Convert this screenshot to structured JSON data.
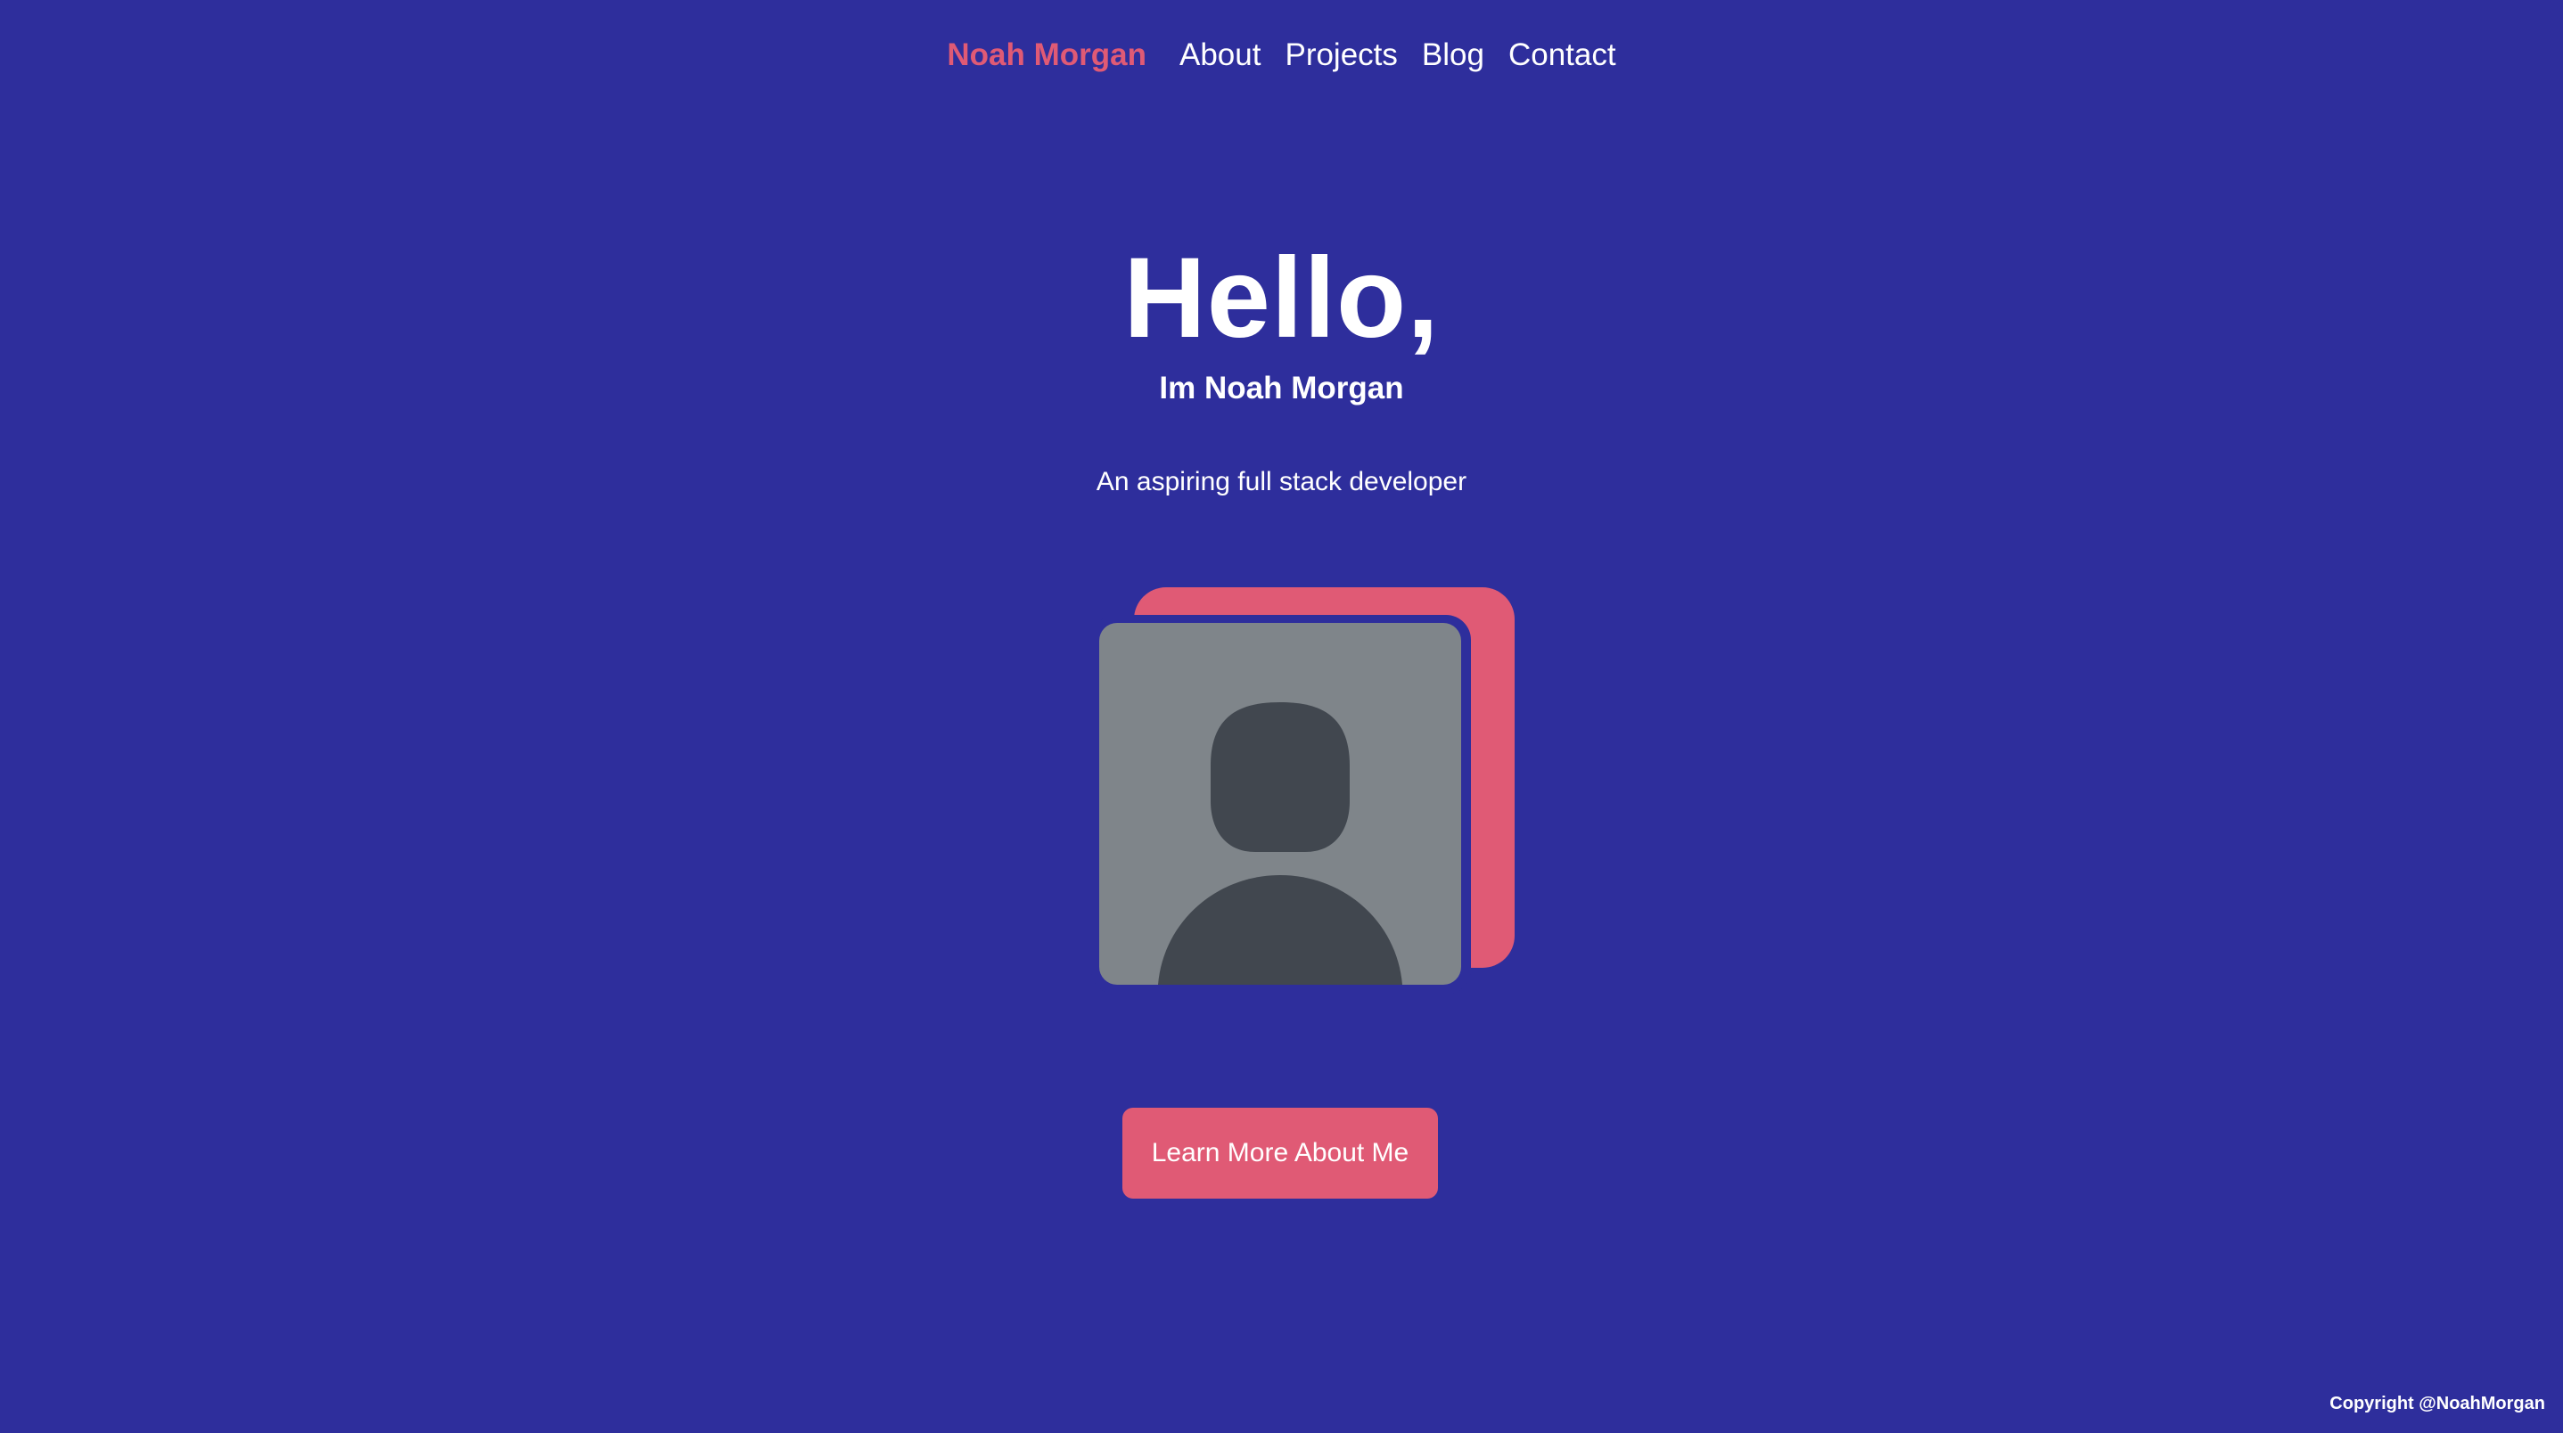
{
  "nav": {
    "brand": "Noah Morgan",
    "links": [
      "About",
      "Projects",
      "Blog",
      "Contact"
    ]
  },
  "hero": {
    "title": "Hello,",
    "subtitle": "Im Noah Morgan",
    "tagline": "An aspiring full stack developer"
  },
  "profile": {
    "icon": "avatar-placeholder-icon"
  },
  "cta": {
    "label": "Learn More About Me"
  },
  "footer": {
    "copyright": "Copyright @NoahMorgan"
  },
  "colors": {
    "background": "#2e2e9c",
    "accent": "#e05a75",
    "avatar_bg": "#7f858a",
    "avatar_fg": "#41474f"
  }
}
